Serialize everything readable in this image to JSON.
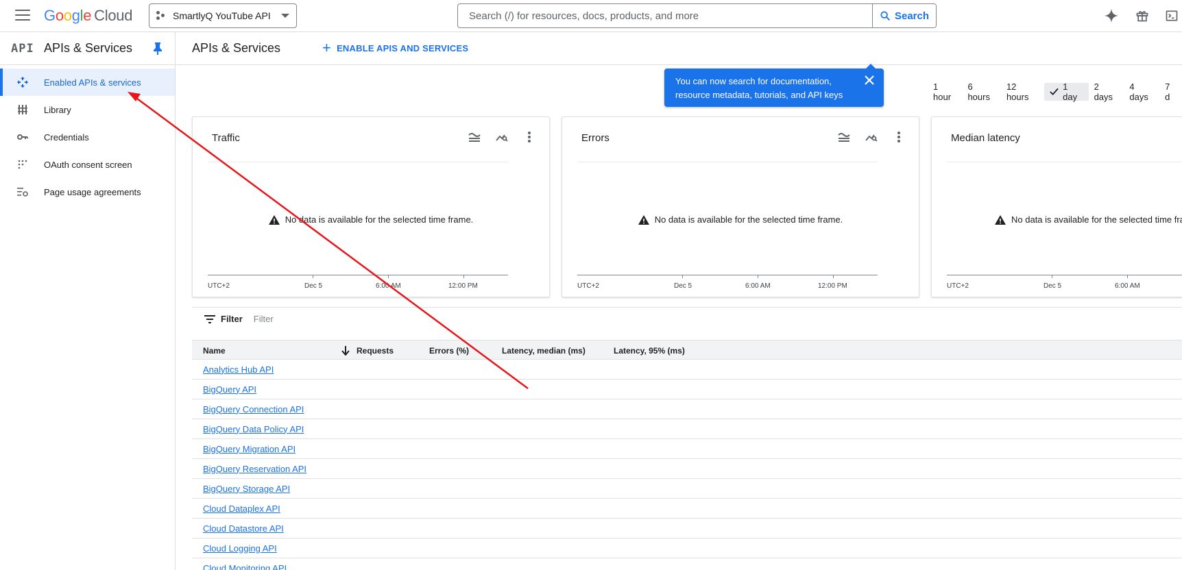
{
  "header": {
    "logo_parts": [
      "G",
      "o",
      "o",
      "g",
      "l",
      "e"
    ],
    "logo_product": "Cloud",
    "project": "SmartlyQ YouTube API",
    "search_placeholder": "Search (/) for resources, docs, products, and more",
    "search_button": "Search"
  },
  "sidebar": {
    "logo": "API",
    "title": "APIs & Services",
    "items": [
      {
        "label": "Enabled APIs & services",
        "icon": "hub-icon",
        "active": true
      },
      {
        "label": "Library",
        "icon": "library-icon",
        "active": false
      },
      {
        "label": "Credentials",
        "icon": "key-icon",
        "active": false
      },
      {
        "label": "OAuth consent screen",
        "icon": "oauth-dots-icon",
        "active": false
      },
      {
        "label": "Page usage agreements",
        "icon": "settings-list-icon",
        "active": false
      }
    ]
  },
  "main": {
    "title": "APIs & Services",
    "enable_button": "ENABLE APIS AND SERVICES",
    "tooltip": "You can now search for documentation, resource metadata, tutorials, and API keys",
    "time_ranges": [
      {
        "label": "1 hour",
        "selected": false
      },
      {
        "label": "6 hours",
        "selected": false
      },
      {
        "label": "12 hours",
        "selected": false
      },
      {
        "label": "1 day",
        "selected": true
      },
      {
        "label": "2 days",
        "selected": false
      },
      {
        "label": "4 days",
        "selected": false
      },
      {
        "label": "7 d",
        "selected": false
      }
    ],
    "cards": [
      {
        "title": "Traffic",
        "nodata": "No data is available for the selected time frame.",
        "axis": [
          "UTC+2",
          "Dec 5",
          "6:00 AM",
          "12:00 PM"
        ]
      },
      {
        "title": "Errors",
        "nodata": "No data is available for the selected time frame.",
        "axis": [
          "UTC+2",
          "Dec 5",
          "6:00 AM",
          "12:00 PM"
        ]
      },
      {
        "title": "Median latency",
        "nodata": "No data is available for the selected time fra",
        "axis": [
          "UTC+2",
          "Dec 5",
          "6:00 AM",
          ""
        ]
      }
    ],
    "filter": {
      "label": "Filter",
      "placeholder": "Filter"
    },
    "table": {
      "columns": [
        "Name",
        "Requests",
        "Errors (%)",
        "Latency, median (ms)",
        "Latency, 95% (ms)"
      ],
      "rows": [
        "Analytics Hub API",
        "BigQuery API",
        "BigQuery Connection API",
        "BigQuery Data Policy API",
        "BigQuery Migration API",
        "BigQuery Reservation API",
        "BigQuery Storage API",
        "Cloud Dataplex API",
        "Cloud Datastore API",
        "Cloud Logging API",
        "Cloud Monitoring API"
      ]
    }
  },
  "colors": {
    "accent": "#1a73e8",
    "annotation_arrow": "#e8161b",
    "tooltip_bg": "#1a73e8"
  }
}
